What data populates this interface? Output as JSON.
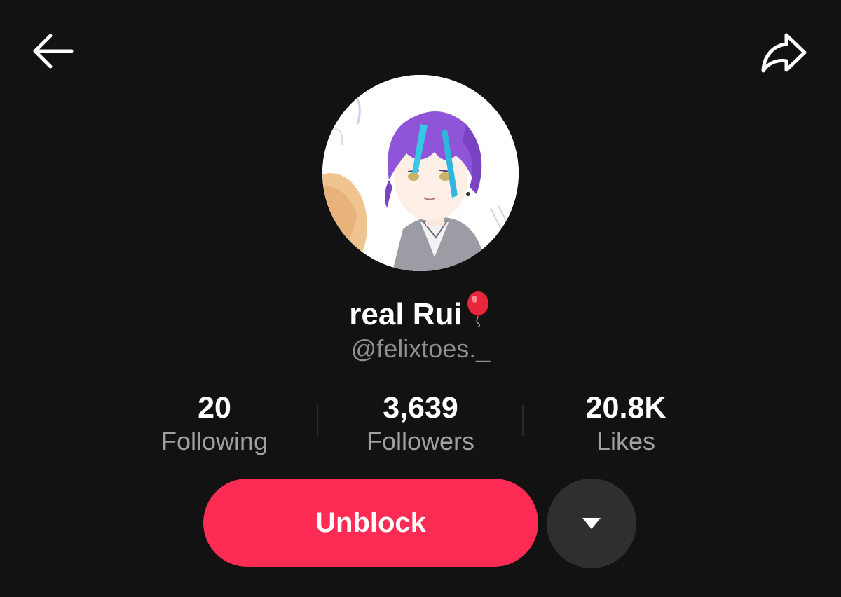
{
  "header": {
    "back_icon": "arrow-left-icon",
    "share_icon": "share-arrow-icon"
  },
  "profile": {
    "avatar_icon": "profile-avatar-illustration",
    "display_name": "real Rui",
    "name_emoji_icon": "red-balloon-icon",
    "username": "@felixtoes._"
  },
  "stats": [
    {
      "value": "20",
      "label": "Following"
    },
    {
      "value": "3,639",
      "label": "Followers"
    },
    {
      "value": "20.8K",
      "label": "Likes"
    }
  ],
  "actions": {
    "unblock_label": "Unblock",
    "more_icon": "caret-down-icon"
  },
  "colors": {
    "background": "#121212",
    "primary": "#fe2c55",
    "secondary_button": "#2f2f2f",
    "muted_text": "#a0a0a0"
  }
}
